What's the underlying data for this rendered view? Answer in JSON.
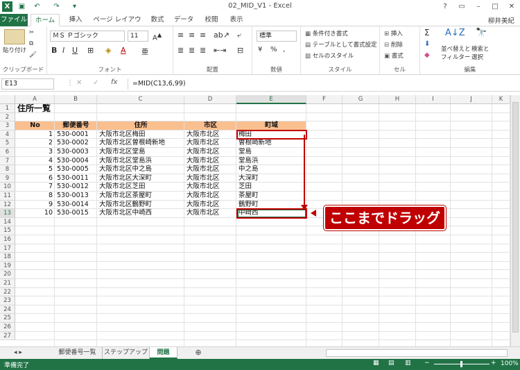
{
  "window": {
    "title": "02_MID_V1 - Excel",
    "user": "柳井美紀"
  },
  "tabs": [
    "ファイル",
    "ホーム",
    "挿入",
    "ページ レイアウト",
    "数式",
    "データ",
    "校閲",
    "表示"
  ],
  "ribbon": {
    "paste": "貼り付け",
    "font_name": "ＭＳ Ｐゴシック",
    "font_size": "11",
    "number_format": "標準",
    "cond_format": "条件付き書式",
    "table_format": "テーブルとして書式設定",
    "cell_style": "セルのスタイル",
    "insert": "挿入",
    "delete": "削除",
    "format": "書式",
    "sort": "並べ替えと",
    "filter": "フィルター",
    "find": "検索と",
    "select": "選択",
    "groups": [
      "クリップボード",
      "フォント",
      "配置",
      "数値",
      "スタイル",
      "セル",
      "編集"
    ]
  },
  "formula_bar": {
    "name_box": "E13",
    "fx": "fx",
    "formula": "=MID(C13,6,99)"
  },
  "columns": [
    "A",
    "B",
    "C",
    "D",
    "E",
    "F",
    "G",
    "H",
    "I",
    "J",
    "K"
  ],
  "rows": [
    "1",
    "2",
    "3",
    "4",
    "5",
    "6",
    "7",
    "8",
    "9",
    "10",
    "11",
    "12",
    "13",
    "14",
    "15",
    "16",
    "17",
    "18",
    "19",
    "20",
    "21",
    "22",
    "23",
    "24",
    "25",
    "26",
    "27"
  ],
  "sheet": {
    "title": "住所一覧",
    "headers": [
      "No",
      "郵便番号",
      "住所",
      "市区",
      "町域"
    ],
    "data": [
      [
        "1",
        "530-0001",
        "大阪市北区梅田",
        "大阪市北区",
        "梅田"
      ],
      [
        "2",
        "530-0002",
        "大阪市北区曽根崎新地",
        "大阪市北区",
        "曽根崎新地"
      ],
      [
        "3",
        "530-0003",
        "大阪市北区堂島",
        "大阪市北区",
        "堂島"
      ],
      [
        "4",
        "530-0004",
        "大阪市北区堂島浜",
        "大阪市北区",
        "堂島浜"
      ],
      [
        "5",
        "530-0005",
        "大阪市北区中之島",
        "大阪市北区",
        "中之島"
      ],
      [
        "6",
        "530-0011",
        "大阪市北区大深町",
        "大阪市北区",
        "大深町"
      ],
      [
        "7",
        "530-0012",
        "大阪市北区芝田",
        "大阪市北区",
        "芝田"
      ],
      [
        "8",
        "530-0013",
        "大阪市北区茶屋町",
        "大阪市北区",
        "茶屋町"
      ],
      [
        "9",
        "530-0014",
        "大阪市北区鶴野町",
        "大阪市北区",
        "鶴野町"
      ],
      [
        "10",
        "530-0015",
        "大阪市北区中崎西",
        "大阪市北区",
        "中崎西"
      ]
    ]
  },
  "callout": "ここまでドラッグ",
  "sheet_tabs": [
    "郵便番号一覧",
    "ステップアップ",
    "問題"
  ],
  "status": {
    "ready": "準備完了",
    "zoom": "100%"
  },
  "colors": {
    "excel_green": "#217346",
    "header_fill": "#fabf8f",
    "callout_red": "#c00000"
  }
}
